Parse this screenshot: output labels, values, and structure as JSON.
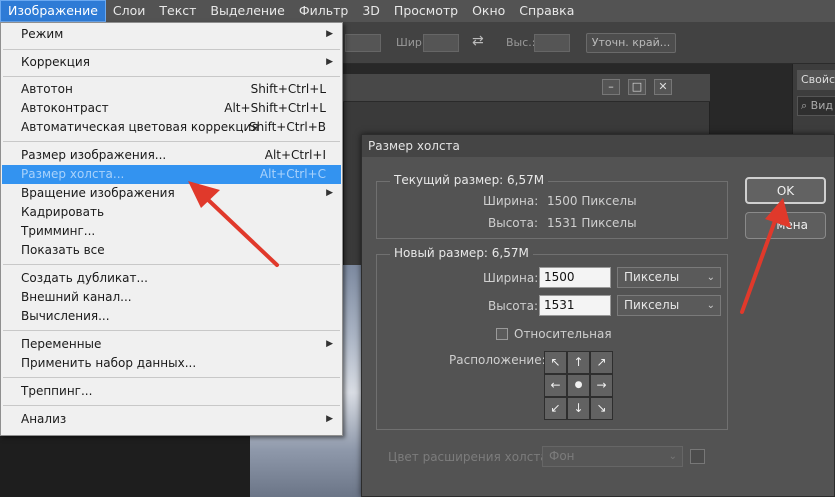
{
  "menubar": {
    "items": [
      "Изображение",
      "Слои",
      "Текст",
      "Выделение",
      "Фильтр",
      "3D",
      "Просмотр",
      "Окно",
      "Справка"
    ]
  },
  "options_bar": {
    "width_label": "Шир.:",
    "height_label": "Выс.:",
    "refine_button": "Уточн. край..."
  },
  "right_panel": {
    "tab": "Свойст",
    "search": "Вид"
  },
  "image_menu": {
    "items": [
      {
        "label": "Режим",
        "shortcut": "",
        "submenu": true
      },
      {
        "label": "Коррекция",
        "shortcut": "",
        "submenu": true
      },
      {
        "label": "Автотон",
        "shortcut": "Shift+Ctrl+L",
        "submenu": false
      },
      {
        "label": "Автоконтраст",
        "shortcut": "Alt+Shift+Ctrl+L",
        "submenu": false
      },
      {
        "label": "Автоматическая цветовая коррекция",
        "shortcut": "Shift+Ctrl+B",
        "submenu": false
      },
      {
        "label": "Размер изображения...",
        "shortcut": "Alt+Ctrl+I",
        "submenu": false
      },
      {
        "label": "Размер холста...",
        "shortcut": "Alt+Ctrl+C",
        "submenu": false
      },
      {
        "label": "Вращение изображения",
        "shortcut": "",
        "submenu": true
      },
      {
        "label": "Кадрировать",
        "shortcut": "",
        "submenu": false
      },
      {
        "label": "Тримминг...",
        "shortcut": "",
        "submenu": false
      },
      {
        "label": "Показать все",
        "shortcut": "",
        "submenu": false
      },
      {
        "label": "Создать дубликат...",
        "shortcut": "",
        "submenu": false
      },
      {
        "label": "Внешний канал...",
        "shortcut": "",
        "submenu": false
      },
      {
        "label": "Вычисления...",
        "shortcut": "",
        "submenu": false
      },
      {
        "label": "Переменные",
        "shortcut": "",
        "submenu": true
      },
      {
        "label": "Применить набор данных...",
        "shortcut": "",
        "submenu": false
      },
      {
        "label": "Треппинг...",
        "shortcut": "",
        "submenu": false
      },
      {
        "label": "Анализ",
        "shortcut": "",
        "submenu": true
      }
    ],
    "highlighted": "Размер холста..."
  },
  "dialog": {
    "title": "Размер холста",
    "current_size": {
      "title": "Текущий размер: 6,57M",
      "width_label": "Ширина:",
      "width_value": "1500 Пикселы",
      "height_label": "Высота:",
      "height_value": "1531 Пикселы"
    },
    "new_size": {
      "title": "Новый размер: 6,57M",
      "width_label": "Ширина:",
      "width_value": "1500",
      "width_unit": "Пикселы",
      "height_label": "Высота:",
      "height_value": "1531",
      "height_unit": "Пикселы",
      "relative_label": "Относительная",
      "relative_checked": false,
      "anchor_label": "Расположение:",
      "anchor_glyphs": [
        "↖",
        "↑",
        "↗",
        "←",
        "●",
        "→",
        "↙",
        "↓",
        "↘"
      ]
    },
    "extension_color_label": "Цвет расширения холста:",
    "extension_color_value": "Фон",
    "ok_button": "OK",
    "cancel_button": "мена"
  },
  "colors": {
    "menu_highlight": "#3393f0",
    "annotation_arrow": "#e0392b"
  }
}
